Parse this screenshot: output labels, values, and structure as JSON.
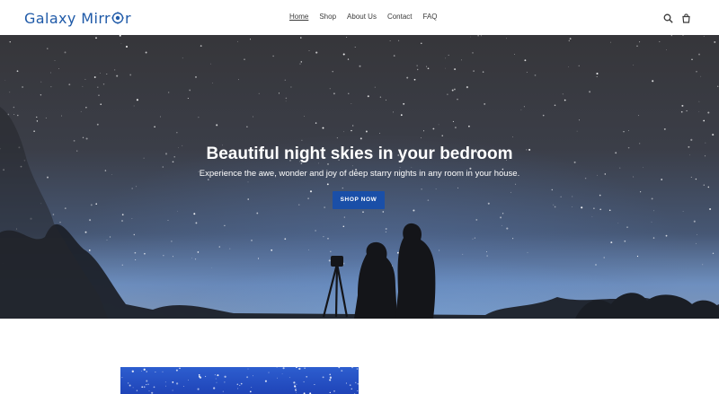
{
  "header": {
    "logo_text_a": "Galaxy Mirr",
    "logo_text_b": "r",
    "nav": [
      {
        "label": "Home",
        "active": true
      },
      {
        "label": "Shop",
        "active": false
      },
      {
        "label": "About Us",
        "active": false
      },
      {
        "label": "Contact",
        "active": false
      },
      {
        "label": "FAQ",
        "active": false
      }
    ],
    "icons": [
      "search-icon",
      "cart-icon"
    ]
  },
  "hero": {
    "title": "Beautiful night skies in your bedroom",
    "subtitle": "Experience the awe, wonder and joy of deep starry nights in any room in your house.",
    "button_label": "SHOP NOW"
  },
  "colors": {
    "brand": "#1f5aa8",
    "button": "#1a4fa8",
    "feature_blue": "#2d5ecf"
  }
}
